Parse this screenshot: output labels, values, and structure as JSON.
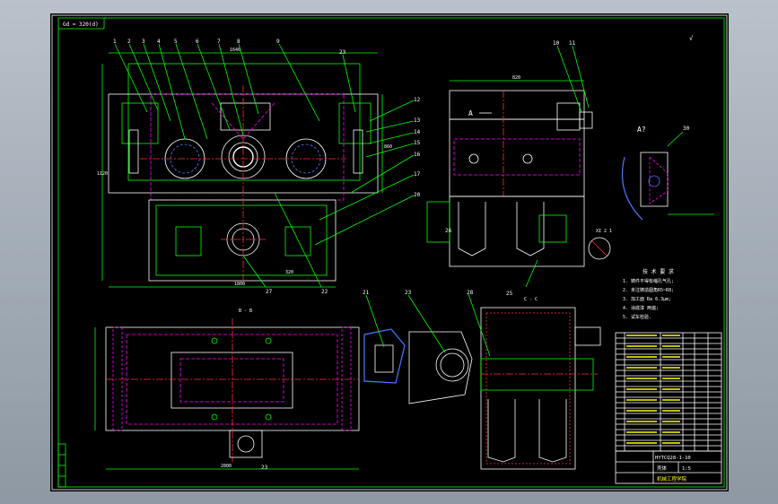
{
  "drawing": {
    "frame_label": "Gd = 320(d)",
    "roughness_mark": "√",
    "part_numbers_top": [
      "1",
      "2",
      "3",
      "4",
      "5",
      "6",
      "7",
      "8",
      "9",
      "10",
      "11",
      "12",
      "13",
      "14",
      "15",
      "16",
      "17",
      "18",
      "19",
      "20",
      "21",
      "22",
      "23",
      "24",
      "25",
      "26",
      "27"
    ],
    "callouts": {
      "n1": "1",
      "n2": "2",
      "n3": "3",
      "n4": "4",
      "n5": "5",
      "n6": "6",
      "n7": "7",
      "n8": "8",
      "n9": "9",
      "n23a": "23",
      "n12": "12",
      "n13": "13",
      "n14": "14",
      "n15": "15",
      "n16": "16",
      "n17": "17",
      "n18": "18",
      "n19": "19",
      "n20": "20",
      "n27": "27",
      "n22": "22",
      "n10": "10",
      "n11": "11",
      "n26": "26",
      "n25": "25",
      "n21": "21",
      "n23b": "23",
      "n28": "28",
      "n23c": "23",
      "n30": "30"
    },
    "view_labels": {
      "a_arrow": "A",
      "a_view": "A?",
      "section_cc": "C - C",
      "section_bb": "B - B",
      "detail": "XI 2 1"
    },
    "dimensions": {
      "d_top": "1640",
      "d_bottom": "1800",
      "d_side": "860",
      "d_mid": "320",
      "d_left": "1120",
      "d_right_view": "820",
      "d_lower": "2800"
    },
    "tech_notes": {
      "title": "技 术 要 求",
      "lines": [
        "1. 铸件不得有缩孔气孔;",
        "2. 未注铸造圆角R5~R8;",
        "3. 加工面 Ra 6.3μm;",
        "4. 涂底漆 两遍;",
        "5. 试车检验."
      ]
    },
    "title_block": {
      "drawing_number": "HYTCQ28-1-10",
      "name": "壳体",
      "school": "机械工程学院",
      "scale": "1:5"
    }
  }
}
